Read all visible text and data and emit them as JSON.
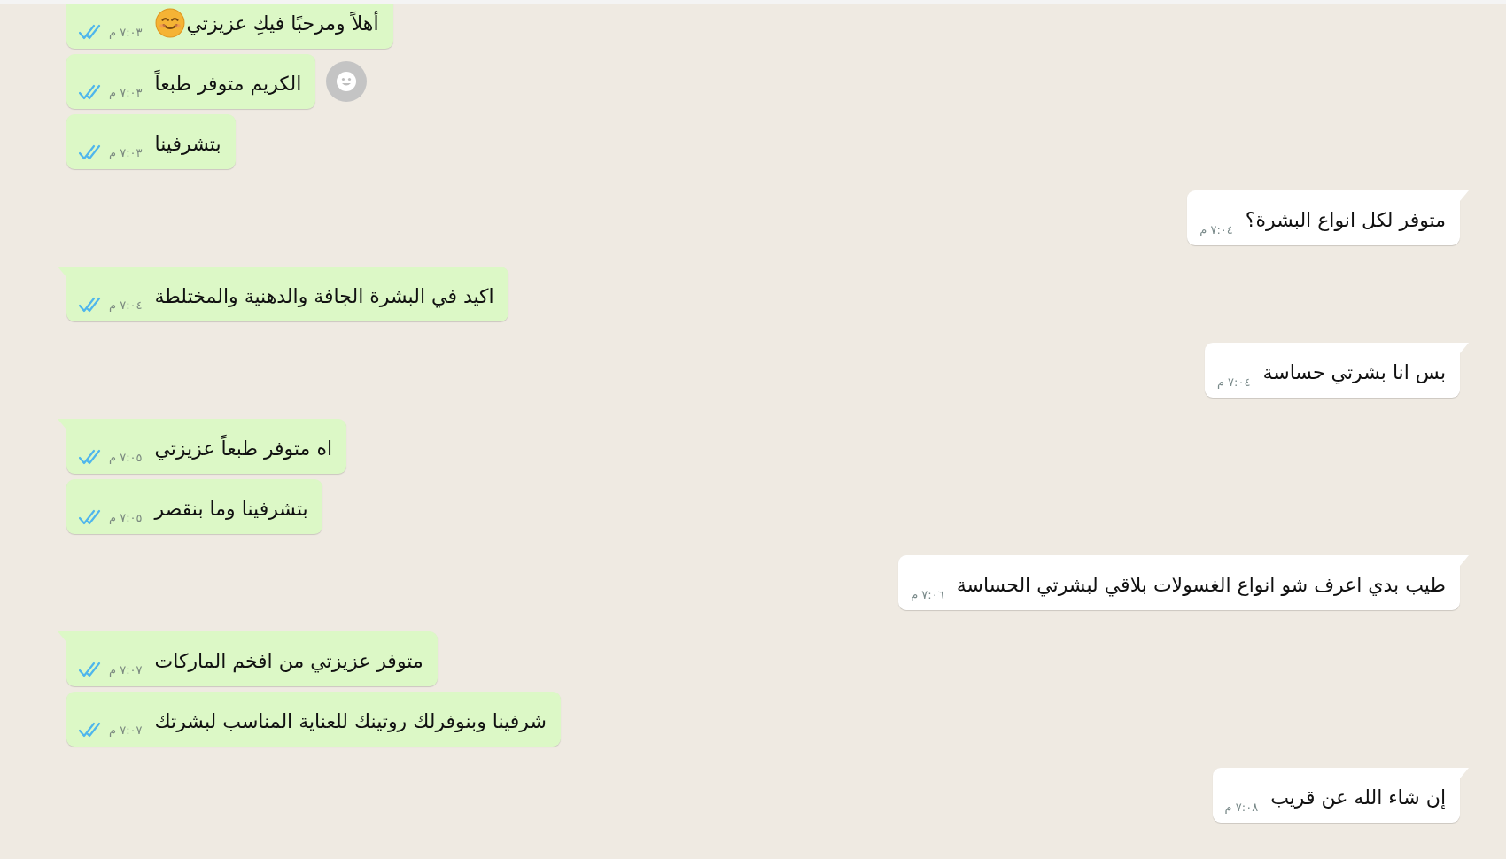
{
  "messages": [
    {
      "kind": "sent",
      "text": "أهلاً ومرحبًا فيكِ عزيزتي",
      "emoji": true,
      "time": "٧:٠٣ م",
      "read": true,
      "tail": false
    },
    {
      "kind": "sent",
      "text": "الكريم متوفر طبعاً",
      "time": "٧:٠٣ م",
      "read": true,
      "tail": false,
      "reaction_button": true
    },
    {
      "kind": "sent",
      "text": "بتشرفينا",
      "time": "٧:٠٣ م",
      "read": true,
      "tail": false
    },
    {
      "kind": "received",
      "text": "متوفر لكل انواع البشرة؟",
      "time": "٧:٠٤ م",
      "tail": true
    },
    {
      "kind": "sent",
      "text": "اكيد في البشرة الجافة والدهنية والمختلطة",
      "time": "٧:٠٤ م",
      "read": true,
      "tail": true
    },
    {
      "kind": "received",
      "text": "بس انا بشرتي حساسة",
      "time": "٧:٠٤ م",
      "tail": true
    },
    {
      "kind": "sent",
      "text": "اه متوفر طبعاً عزيزتي",
      "time": "٧:٠٥ م",
      "read": true,
      "tail": true
    },
    {
      "kind": "sent",
      "text": "بتشرفينا وما بنقصر",
      "time": "٧:٠٥ م",
      "read": true,
      "tail": false
    },
    {
      "kind": "received",
      "text": "طيب بدي اعرف شو انواع الغسولات بلاقي لبشرتي الحساسة",
      "time": "٧:٠٦ م",
      "tail": true
    },
    {
      "kind": "sent",
      "text": "متوفر عزيزتي من افخم الماركات",
      "time": "٧:٠٧ م",
      "read": true,
      "tail": true
    },
    {
      "kind": "sent",
      "text": "شرفينا وبنوفرلك روتينك للعناية المناسب لبشرتك",
      "time": "٧:٠٧ م",
      "read": true,
      "tail": false
    },
    {
      "kind": "received",
      "text": "إن شاء الله عن قريب",
      "time": "٧:٠٨ م",
      "tail": true
    }
  ]
}
